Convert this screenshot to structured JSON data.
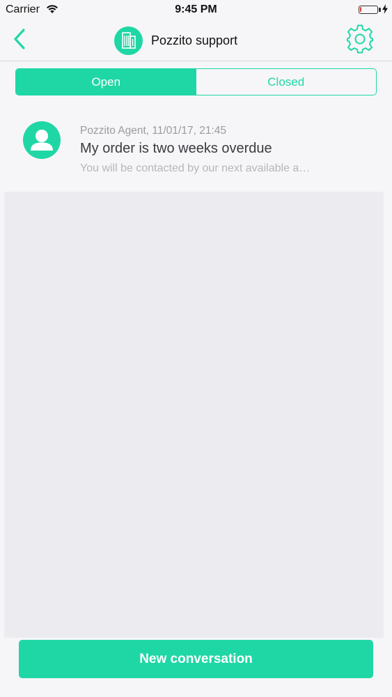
{
  "status_bar": {
    "carrier": "Carrier",
    "time": "9:45 PM",
    "battery_level": 0.08,
    "icons": [
      "wifi-icon",
      "battery-icon",
      "charging-icon"
    ]
  },
  "nav": {
    "title": "Pozzito support",
    "icons": [
      "back-chevron-icon",
      "building-icon",
      "gear-icon"
    ]
  },
  "tabs": [
    {
      "label": "Open",
      "active": true
    },
    {
      "label": "Closed",
      "active": false
    }
  ],
  "conversations": [
    {
      "meta": "Pozzito Agent, 11/01/17, 21:45",
      "subject": "My order is two weeks overdue",
      "preview": "You will be contacted by our next available a…",
      "icon": "user-avatar-icon"
    }
  ],
  "footer": {
    "new_conversation_label": "New conversation"
  },
  "colors": {
    "accent": "#1fd7a5",
    "background": "#f6f6f8",
    "empty_area": "#ececf0",
    "meta_text": "#9a9aa0",
    "preview_text": "#b6b6bb",
    "battery_low": "#e53935"
  }
}
